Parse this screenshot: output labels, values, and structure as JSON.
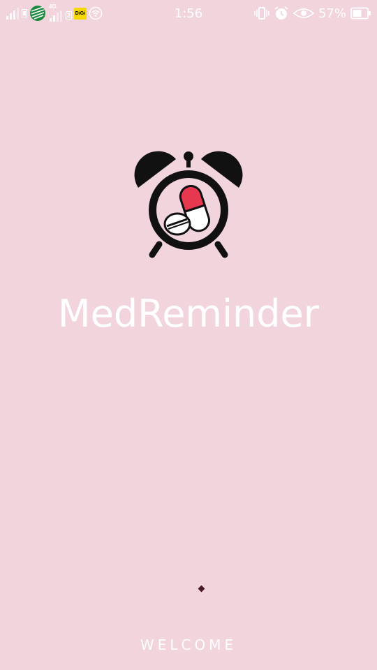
{
  "status_bar": {
    "time": "1:56",
    "sim2_number": "2",
    "carrier_badge": "DiGi",
    "network_type": "4G",
    "battery_percent": "57%",
    "icons": [
      "signal-icon",
      "sim1-icon",
      "carrier-logo-icon",
      "signal-icon",
      "sim2-icon",
      "digi-icon",
      "hotspot-icon",
      "vibrate-icon",
      "alarm-icon",
      "eye-icon",
      "battery-icon"
    ]
  },
  "splash": {
    "app_name": "MedReminder",
    "welcome_text": "WELCOME",
    "logo_icon": "alarm-clock-pill-icon"
  },
  "colors": {
    "background": "#f1d4dc",
    "text": "#ffffff",
    "pill_red": "#e8384f",
    "logo_black": "#111111",
    "dot": "#4a1a24"
  }
}
